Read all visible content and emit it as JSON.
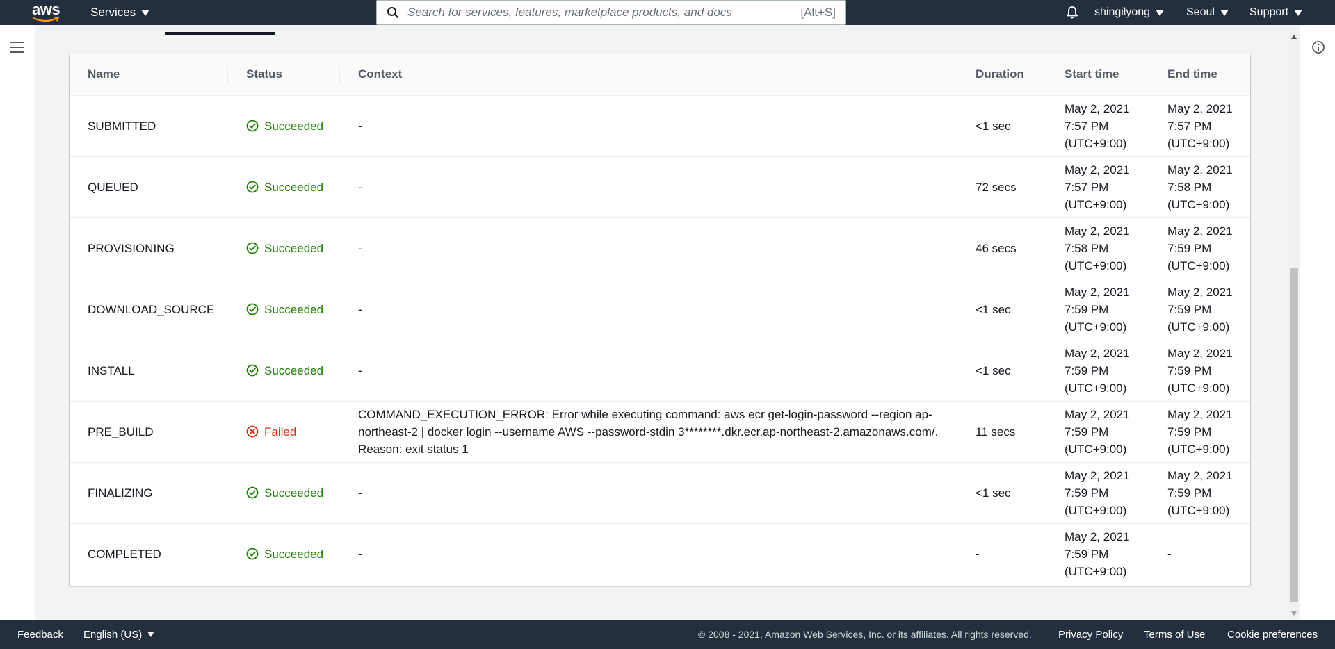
{
  "nav": {
    "logo_text": "aws",
    "services_label": "Services",
    "search_placeholder": "Search for services, features, marketplace products, and docs",
    "search_shortcut": "[Alt+S]",
    "user_label": "shingilyong",
    "region_label": "Seoul",
    "support_label": "Support"
  },
  "table": {
    "headers": [
      "Name",
      "Status",
      "Context",
      "Duration",
      "Start time",
      "End time"
    ],
    "rows": [
      {
        "name": "SUBMITTED",
        "status": "Succeeded",
        "context": "-",
        "duration": "<1 sec",
        "start": [
          "May 2, 2021",
          "7:57 PM",
          "(UTC+9:00)"
        ],
        "end": [
          "May 2, 2021",
          "7:57 PM",
          "(UTC+9:00)"
        ]
      },
      {
        "name": "QUEUED",
        "status": "Succeeded",
        "context": "-",
        "duration": "72 secs",
        "start": [
          "May 2, 2021",
          "7:57 PM",
          "(UTC+9:00)"
        ],
        "end": [
          "May 2, 2021",
          "7:58 PM",
          "(UTC+9:00)"
        ]
      },
      {
        "name": "PROVISIONING",
        "status": "Succeeded",
        "context": "-",
        "duration": "46 secs",
        "start": [
          "May 2, 2021",
          "7:58 PM",
          "(UTC+9:00)"
        ],
        "end": [
          "May 2, 2021",
          "7:59 PM",
          "(UTC+9:00)"
        ]
      },
      {
        "name": "DOWNLOAD_SOURCE",
        "status": "Succeeded",
        "context": "-",
        "duration": "<1 sec",
        "start": [
          "May 2, 2021",
          "7:59 PM",
          "(UTC+9:00)"
        ],
        "end": [
          "May 2, 2021",
          "7:59 PM",
          "(UTC+9:00)"
        ]
      },
      {
        "name": "INSTALL",
        "status": "Succeeded",
        "context": "-",
        "duration": "<1 sec",
        "start": [
          "May 2, 2021",
          "7:59 PM",
          "(UTC+9:00)"
        ],
        "end": [
          "May 2, 2021",
          "7:59 PM",
          "(UTC+9:00)"
        ]
      },
      {
        "name": "PRE_BUILD",
        "status": "Failed",
        "context": "COMMAND_EXECUTION_ERROR: Error while executing command: aws ecr get-login-password --region ap-northeast-2 | docker login --username AWS --password-stdin 3********.dkr.ecr.ap-northeast-2.amazonaws.com/. Reason: exit status 1",
        "duration": "11 secs",
        "start": [
          "May 2, 2021",
          "7:59 PM",
          "(UTC+9:00)"
        ],
        "end": [
          "May 2, 2021",
          "7:59 PM",
          "(UTC+9:00)"
        ]
      },
      {
        "name": "FINALIZING",
        "status": "Succeeded",
        "context": "-",
        "duration": "<1 sec",
        "start": [
          "May 2, 2021",
          "7:59 PM",
          "(UTC+9:00)"
        ],
        "end": [
          "May 2, 2021",
          "7:59 PM",
          "(UTC+9:00)"
        ]
      },
      {
        "name": "COMPLETED",
        "status": "Succeeded",
        "context": "-",
        "duration": "-",
        "start": [
          "May 2, 2021",
          "7:59 PM",
          "(UTC+9:00)"
        ],
        "end": [
          "-"
        ]
      }
    ]
  },
  "footer": {
    "feedback": "Feedback",
    "language": "English (US)",
    "copyright": "© 2008 - 2021, Amazon Web Services, Inc. or its affiliates. All rights reserved.",
    "privacy": "Privacy Policy",
    "terms": "Terms of Use",
    "cookies": "Cookie preferences"
  },
  "colors": {
    "nav_bg": "#232f3e",
    "success": "#1d8102",
    "error": "#d13212",
    "aws_orange": "#ff9900"
  },
  "icons": {
    "success": "check-circle-icon",
    "failed": "x-circle-icon"
  }
}
